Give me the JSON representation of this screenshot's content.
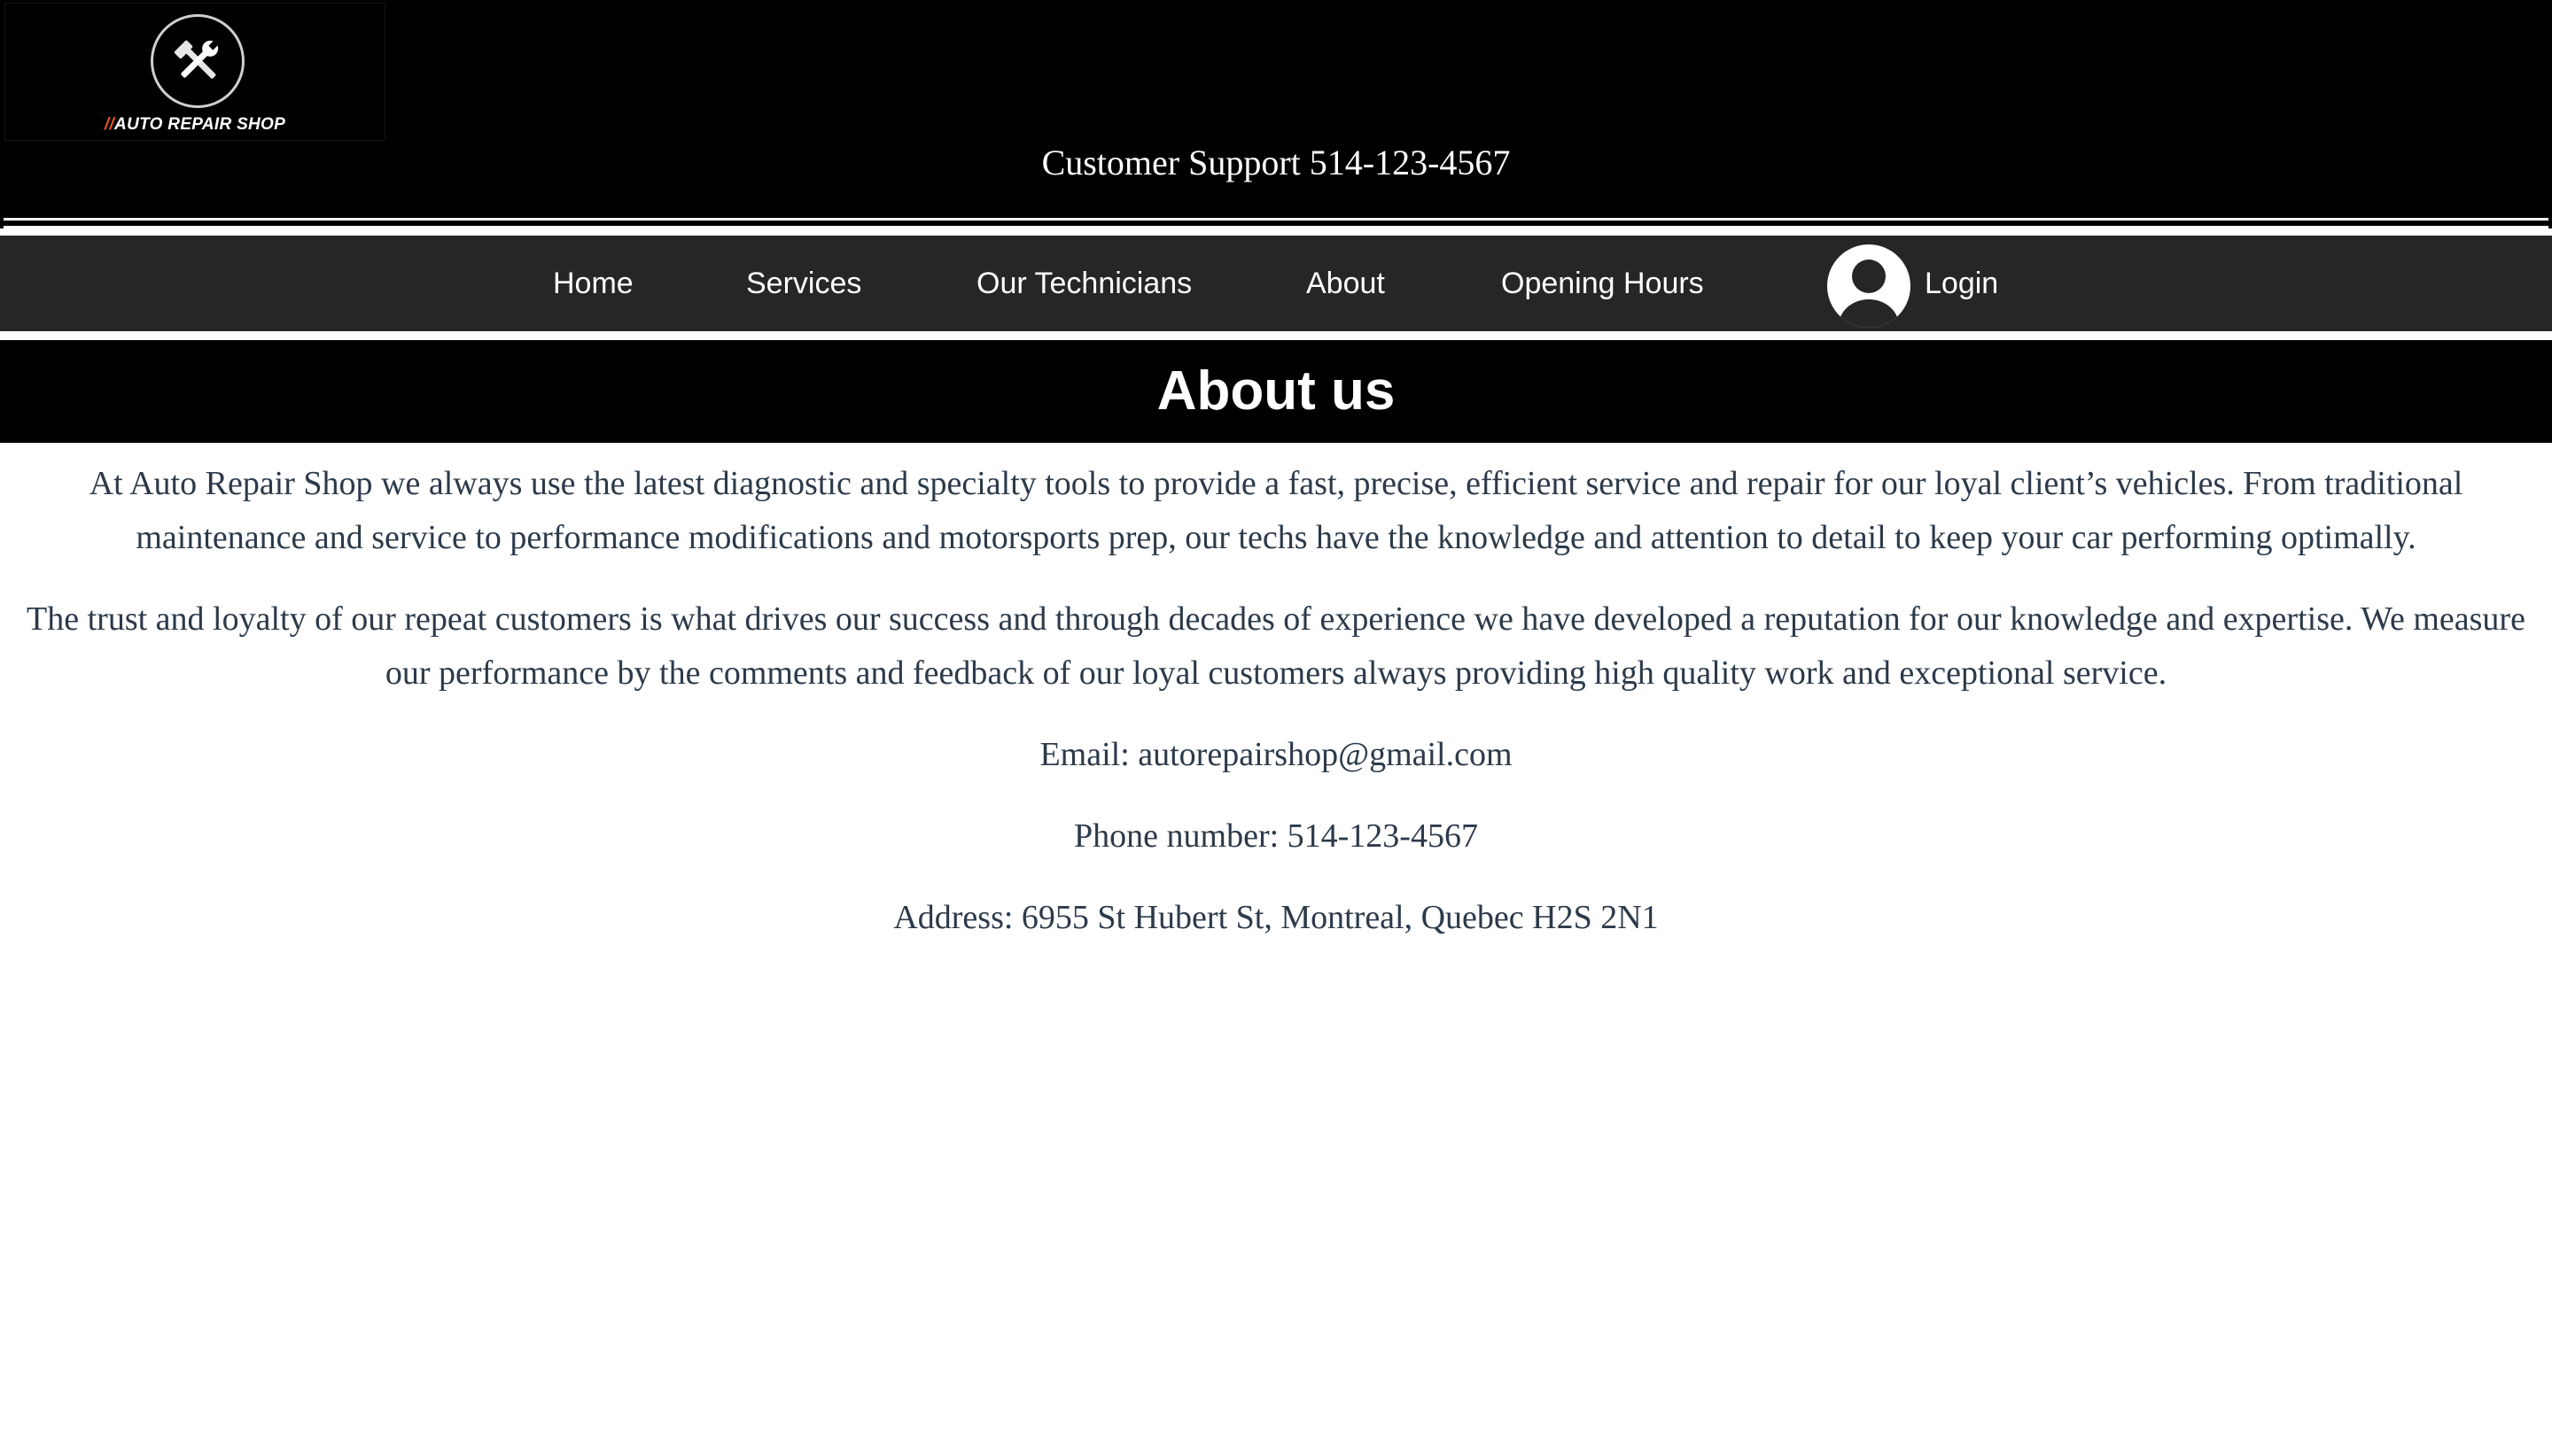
{
  "header": {
    "logo": {
      "icon": "hammer-wrench-icon",
      "slashes": "//",
      "brand_text": "AUTO REPAIR SHOP",
      "slash_color": "#e8542a"
    },
    "support_text": "Customer Support 514-123-4567"
  },
  "nav": {
    "items": [
      {
        "label": "Home"
      },
      {
        "label": "Services"
      },
      {
        "label": "Our Technicians"
      },
      {
        "label": "About"
      },
      {
        "label": "Opening Hours"
      }
    ],
    "login": {
      "icon": "user-avatar-icon",
      "label": "Login"
    }
  },
  "about": {
    "title": "About us",
    "paragraphs": [
      "At Auto Repair Shop we always use the latest diagnostic and specialty tools to provide a fast, precise, efficient service and repair for our loyal client’s vehicles. From traditional maintenance and service to performance modifications and motorsports prep, our techs have the knowledge and attention to detail to keep your car performing optimally.",
      "The trust and loyalty of our repeat customers is what drives our success and through decades of experience we have developed a reputation for our knowledge and expertise. We measure our performance by the comments and feedback of our loyal customers always providing high quality work and exceptional service."
    ],
    "email_line": "Email: autorepairshop@gmail.com",
    "phone_line": "Phone number: 514-123-4567",
    "address_line": "Address: 6955 St Hubert St, Montreal, Quebec H2S 2N1"
  },
  "colors": {
    "header_bg": "#000000",
    "nav_bg": "#262626",
    "body_text": "#2c3a4a"
  }
}
